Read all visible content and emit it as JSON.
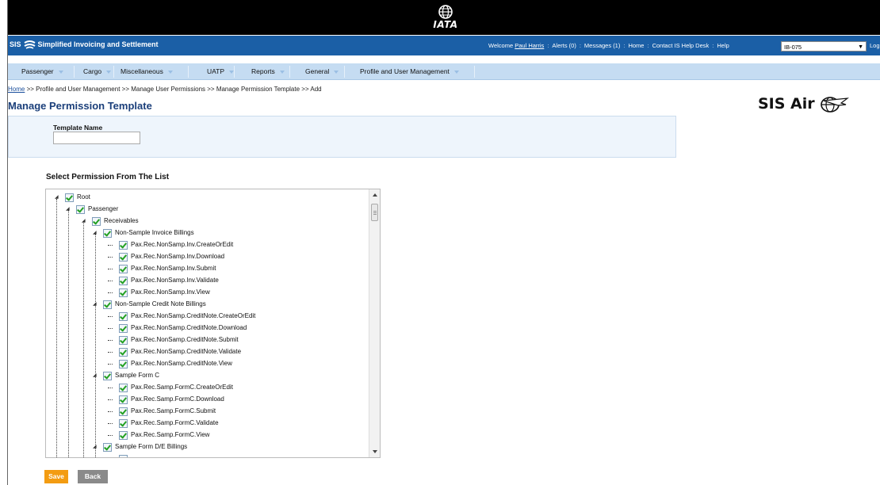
{
  "header": {
    "iata_logo_text": "IATA",
    "brand_prefix": "SIS",
    "brand_name": "Simplified Invoicing and Settlement",
    "welcome_label": "Welcome",
    "user_name": "Paul Harris",
    "alerts": "Alerts (0)",
    "messages": "Messages (1)",
    "home": "Home",
    "contact": "Contact IS Help Desk",
    "help": "Help",
    "airline_select_value": "IB-075",
    "logoff": "Log Off"
  },
  "menu": {
    "items": [
      {
        "label": "Passenger"
      },
      {
        "label": "Cargo"
      },
      {
        "label": "Miscellaneous"
      },
      {
        "label": "UATP"
      },
      {
        "label": "Reports"
      },
      {
        "label": "General"
      },
      {
        "label": "Profile and User Management"
      }
    ]
  },
  "breadcrumb": {
    "home": "Home",
    "rest": ">> Profile and User Management >> Manage User Permissions >> Manage Permission Template >> Add"
  },
  "page": {
    "title": "Manage Permission Template",
    "brand_logo": "SIS Air",
    "template_name_label": "Template Name",
    "template_name_value": "",
    "select_title": "Select Permission From The List"
  },
  "tree": {
    "rows": [
      {
        "label": "Root",
        "checked": true
      },
      {
        "label": "Passenger",
        "checked": true
      },
      {
        "label": "Receivables",
        "checked": true
      },
      {
        "label": "Non-Sample Invoice Billings",
        "checked": true
      },
      {
        "label": "Pax.Rec.NonSamp.Inv.CreateOrEdit",
        "checked": true
      },
      {
        "label": "Pax.Rec.NonSamp.Inv.Download",
        "checked": true
      },
      {
        "label": "Pax.Rec.NonSamp.Inv.Submit",
        "checked": true
      },
      {
        "label": "Pax.Rec.NonSamp.Inv.Validate",
        "checked": true
      },
      {
        "label": "Pax.Rec.NonSamp.Inv.View",
        "checked": true
      },
      {
        "label": "Non-Sample Credit Note Billings",
        "checked": true
      },
      {
        "label": "Pax.Rec.NonSamp.CreditNote.CreateOrEdit",
        "checked": true
      },
      {
        "label": "Pax.Rec.NonSamp.CreditNote.Download",
        "checked": true
      },
      {
        "label": "Pax.Rec.NonSamp.CreditNote.Submit",
        "checked": true
      },
      {
        "label": "Pax.Rec.NonSamp.CreditNote.Validate",
        "checked": true
      },
      {
        "label": "Pax.Rec.NonSamp.CreditNote.View",
        "checked": true
      },
      {
        "label": "Sample Form C",
        "checked": true
      },
      {
        "label": "Pax.Rec.Samp.FormC.CreateOrEdit",
        "checked": true
      },
      {
        "label": "Pax.Rec.Samp.FormC.Download",
        "checked": true
      },
      {
        "label": "Pax.Rec.Samp.FormC.Submit",
        "checked": true
      },
      {
        "label": "Pax.Rec.Samp.FormC.Validate",
        "checked": true
      },
      {
        "label": "Pax.Rec.Samp.FormC.View",
        "checked": true
      },
      {
        "label": "Sample Form D/E Billings",
        "checked": true
      }
    ]
  },
  "actions": {
    "save": "Save",
    "back": "Back"
  },
  "colors": {
    "topbar": "#000000",
    "bluebar": "#1b5fa6",
    "menubar": "#c5dcf2",
    "save": "#f39c12",
    "back": "#8a8a8a",
    "title": "#1b3f7a"
  }
}
